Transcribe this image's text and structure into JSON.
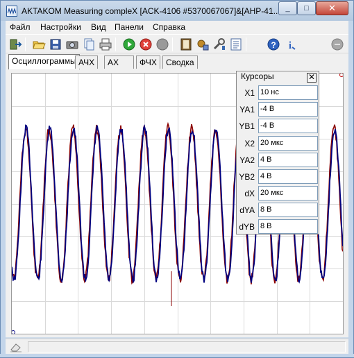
{
  "window": {
    "title": "AKTAKOM Measuring compleX [ACK-4106 #5370067067]&[AHP-41...",
    "minimize": "_",
    "maximize": "□",
    "close": "✕"
  },
  "menu": [
    "Файл",
    "Настройки",
    "Вид",
    "Панели",
    "Справка"
  ],
  "toolbar": [
    "exit-icon",
    "open-folder-icon",
    "save-icon",
    "camera-icon",
    "copy-icon",
    "print-icon",
    "run-icon",
    "stop-icon",
    "pause-icon",
    "panel-icon",
    "settings-icon",
    "tools-icon",
    "list-icon",
    "help-icon",
    "info-icon",
    "disabled-icon"
  ],
  "tabs": [
    "Осциллограммы",
    "АЧХ",
    "АХ",
    "ФЧХ",
    "Сводка"
  ],
  "cursors": {
    "title": "Курсоры",
    "close": "✕",
    "rows": [
      {
        "label": "X1",
        "value": "10 нс"
      },
      {
        "label": "YA1",
        "value": "-4 В"
      },
      {
        "label": "YB1",
        "value": "-4 В"
      },
      {
        "label": "X2",
        "value": "20 мкс"
      },
      {
        "label": "YA2",
        "value": "4 В"
      },
      {
        "label": "YB2",
        "value": "4 В"
      },
      {
        "label": "dX",
        "value": "20 мкс"
      },
      {
        "label": "dYA",
        "value": "8 В"
      },
      {
        "label": "dYB",
        "value": "8 В"
      }
    ]
  },
  "colors": {
    "channel_a": "#00007f",
    "channel_b": "#8b0000",
    "grid": "#d9d9d9",
    "cursor_marker": "#c00000"
  }
}
